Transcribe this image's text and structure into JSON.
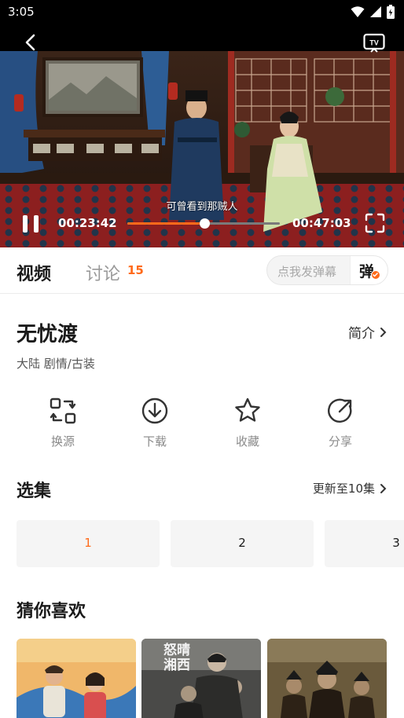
{
  "status_bar": {
    "time": "3:05"
  },
  "player": {
    "subtitle": "可曾看到那贼人",
    "current_time": "00:23:42",
    "total_time": "00:47:03",
    "progress_fraction": 0.504
  },
  "tabs": {
    "video_label": "视频",
    "discuss_label": "讨论",
    "discuss_count": "15",
    "danmaku_placeholder": "点我发弹幕",
    "danmaku_button": "弹"
  },
  "show": {
    "title": "无忧渡",
    "intro_label": "简介",
    "meta": "大陆  剧情/古装"
  },
  "actions": [
    {
      "label": "换源",
      "icon": "switch-source-icon"
    },
    {
      "label": "下载",
      "icon": "download-icon"
    },
    {
      "label": "收藏",
      "icon": "star-icon"
    },
    {
      "label": "分享",
      "icon": "share-icon"
    }
  ],
  "episodes": {
    "title": "选集",
    "update_label": "更新至10集",
    "items": [
      "1",
      "2",
      "3"
    ],
    "active_index": 0
  },
  "recommend": {
    "title": "猜你喜欢",
    "posters": [
      {
        "caption": ""
      },
      {
        "caption": "怒晴湘西"
      },
      {
        "caption": ""
      }
    ]
  },
  "colors": {
    "accent": "#ff6a1a",
    "status_bar_bg": "#000000",
    "episode_bg": "#f5f5f5"
  }
}
